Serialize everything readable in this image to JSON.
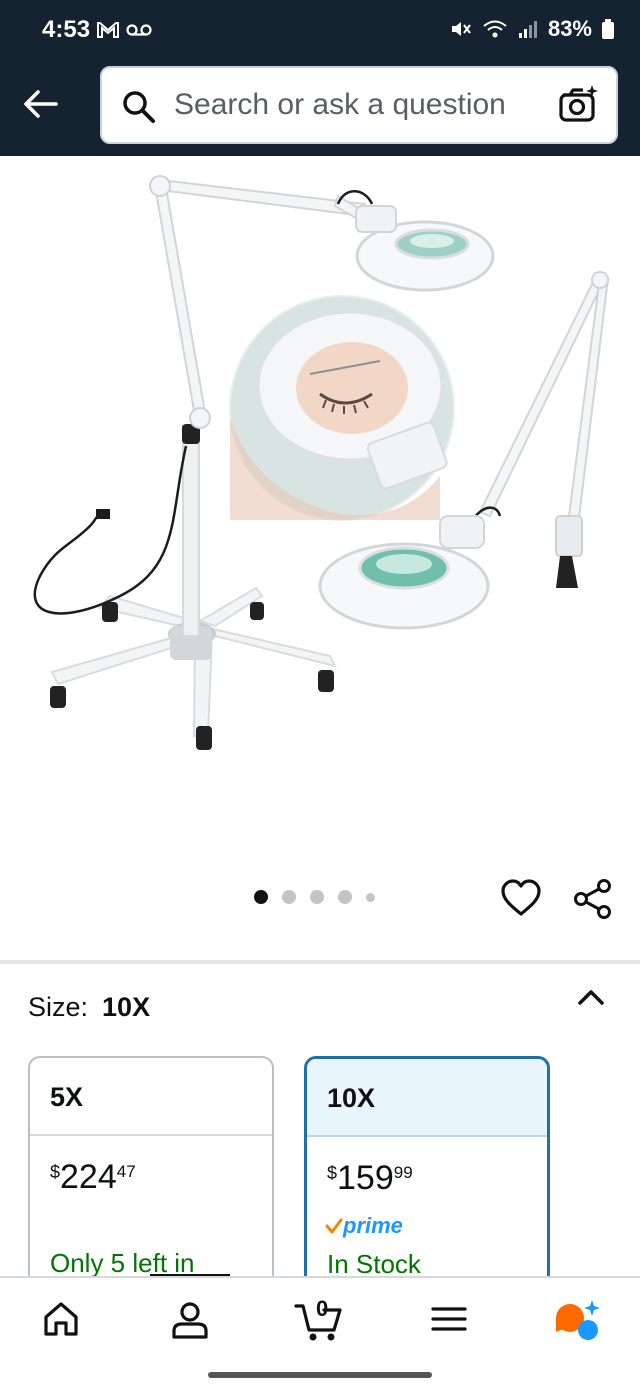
{
  "status_bar": {
    "time": "4:53",
    "battery": "83%"
  },
  "header": {
    "search_placeholder": "Search or ask a question"
  },
  "carousel": {
    "dot_count": 5,
    "active_index": 0
  },
  "size_selector": {
    "label": "Size:",
    "selected": "10X",
    "options": [
      {
        "name": "5X",
        "price_symbol": "$",
        "price_whole": "224",
        "price_fraction": "47",
        "availability": "Only 5 left in"
      },
      {
        "name": "10X",
        "price_symbol": "$",
        "price_whole": "159",
        "price_fraction": "99",
        "prime": "prime",
        "availability": "In Stock"
      }
    ]
  },
  "bottom_nav": {
    "cart_count": "0"
  },
  "colors": {
    "header_bg": "#152230",
    "selected_border": "#1f6fad",
    "in_stock": "#007600",
    "prime_blue": "#1a98ff",
    "prime_check": "#f08804",
    "assistant_orange": "#ff6a00",
    "assistant_blue": "#1a98ff"
  }
}
